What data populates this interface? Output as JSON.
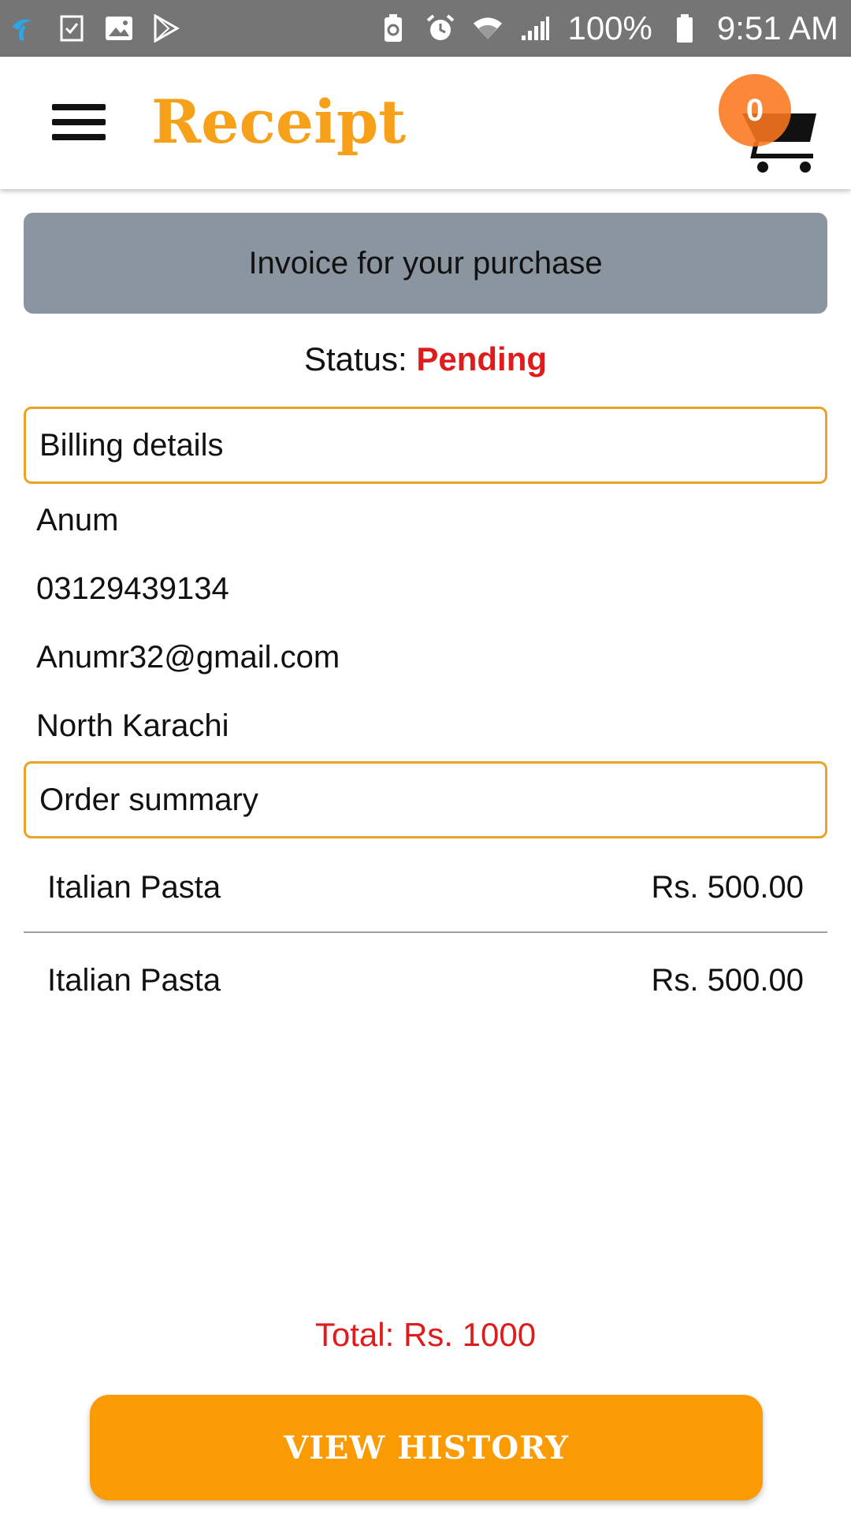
{
  "status_bar": {
    "battery_percent": "100%",
    "time": "9:51 AM",
    "left_icons": [
      "carrier-logo-icon",
      "checklist-icon",
      "gallery-icon",
      "play-store-icon"
    ],
    "right_icons": [
      "battery-saver-icon",
      "alarm-icon",
      "wifi-icon",
      "signal-icon",
      "battery-icon"
    ]
  },
  "app_bar": {
    "title": "Receipt",
    "cart_count": "0",
    "accent_color": "#f7a11a"
  },
  "invoice": {
    "banner": "Invoice for your purchase",
    "status_label": "Status: ",
    "status_value": "Pending"
  },
  "billing": {
    "header": "Billing details",
    "name": "Anum",
    "phone": "03129439134",
    "email": "Anumr32@gmail.com",
    "address": "North Karachi"
  },
  "order": {
    "header": "Order summary",
    "items": [
      {
        "name": "Italian Pasta",
        "price": "Rs. 500.00"
      },
      {
        "name": "Italian Pasta",
        "price": "Rs. 500.00"
      }
    ],
    "total": "Total: Rs. 1000"
  },
  "actions": {
    "view_history": "VIEW HISTORY"
  },
  "colors": {
    "status_bar": "#757575",
    "banner": "#8a959f",
    "pending": "#e01b1b",
    "button": "#fb9b04",
    "section_border": "#e9a326"
  }
}
